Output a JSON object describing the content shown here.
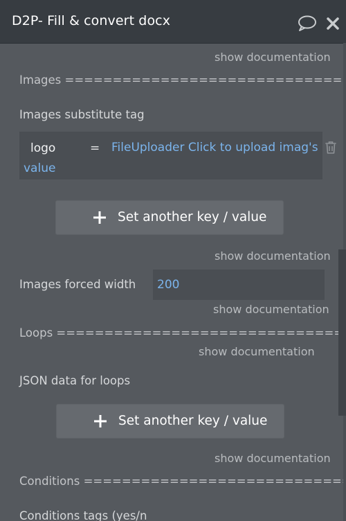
{
  "window": {
    "title": "D2P- Fill & convert docx"
  },
  "docs": {
    "show_documentation": "show documentation"
  },
  "sections": {
    "images_header": "Images ====================================",
    "images_substitute_label": "Images substitute tag",
    "images_forced_width_label": "Images forced width",
    "loops_header": "Loops ====================================",
    "json_data_label": "JSON data for loops",
    "conditions_header": "Conditions ================================",
    "conditions_tags_label": "Conditions tags (yes/n"
  },
  "kv_row": {
    "key": "logo",
    "eq": "=",
    "value": "FileUploader Click to upload imag's value"
  },
  "buttons": {
    "set_another": "Set another key / value"
  },
  "inputs": {
    "images_forced_width": "200"
  },
  "colors": {
    "panel_bg": "#55595e",
    "header_bg": "#373c41",
    "dynamic_value": "#7bb4ec"
  }
}
